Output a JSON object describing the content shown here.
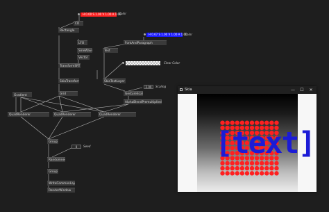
{
  "colors": {
    "bg": "#1e1e1e",
    "node": "#3a3a3a",
    "wire": "#b0b0b0",
    "red_color": "#ff2020",
    "blue_color": "#1a1aff",
    "window_text": "#1b1bd6"
  },
  "colorNodes": [
    {
      "value": "H 0.00 S 1.00 V 1.00 A 1.00",
      "label": "Color"
    },
    {
      "value": "H 0.67 S 1.00 V 1.00 A 1.00",
      "label": "Color"
    }
  ],
  "nodes": [
    {
      "name": "node-cd",
      "label": "CD"
    },
    {
      "name": "node-rectangle",
      "label": "Rectangle"
    },
    {
      "name": "node-lfo",
      "label": "LFO"
    },
    {
      "name": "node-sinewave",
      "label": "SineWave"
    },
    {
      "name": "node-vector",
      "label": "Vector"
    },
    {
      "name": "node-transformsrt",
      "label": "TransformSRT"
    },
    {
      "name": "node-skiatext",
      "label": "Text"
    },
    {
      "name": "node-fontandparagraph",
      "label": "FontAndParagraph"
    },
    {
      "name": "node-skiashape",
      "label": "SkiaTransform"
    },
    {
      "name": "node-skiatextlayer",
      "label": "SkiaTextLayer"
    },
    {
      "name": "node-grid",
      "label": "Grid"
    },
    {
      "name": "node-gradient",
      "label": "Gradient"
    },
    {
      "name": "node-gesturescale",
      "label": "GestureScale"
    },
    {
      "name": "node-alphablend",
      "label": "AlphaBlendPremultiplied"
    },
    {
      "name": "node-quadrenderer-1",
      "label": "QuadRenderer"
    },
    {
      "name": "node-quadrenderer-2",
      "label": "QuadRenderer"
    },
    {
      "name": "node-quadrenderer-3",
      "label": "QuadRenderer"
    },
    {
      "name": "node-group",
      "label": "Group"
    },
    {
      "name": "node-randomness",
      "label": "Randomness"
    },
    {
      "name": "node-group-2",
      "label": "Group"
    },
    {
      "name": "node-writecommonlayer",
      "label": "WriteCommonLayer"
    },
    {
      "name": "node-renderwindow",
      "label": "RenderWindow"
    }
  ],
  "io": {
    "scaling_value": "2.00",
    "scaling_label": "Scaling",
    "seed_value": "0",
    "seed_label": "Seed"
  },
  "clear_color_label": "Clear Color",
  "window": {
    "title": "Skia",
    "minimize": "—",
    "maximize": "☐",
    "close": "✕",
    "text": "[text]"
  }
}
